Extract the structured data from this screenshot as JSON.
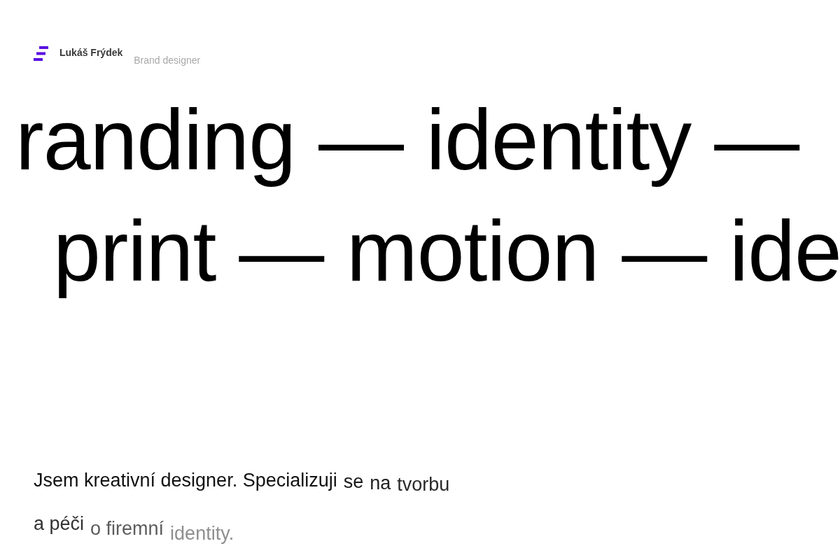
{
  "header": {
    "name": "Lukáš Frýdek",
    "role": "Brand designer"
  },
  "marquee": [
    "randing — identity —",
    "print — motion — ide"
  ],
  "intro": [
    [
      {
        "text": "Jsem kreativní designer. Specializuji",
        "color": "#111111"
      },
      {
        "text": "se",
        "color": "#1a1a1a"
      },
      {
        "text": "na",
        "color": "#222222"
      },
      {
        "text": "tvorbu",
        "color": "#2a2a2a"
      }
    ],
    [
      {
        "text": "a péči",
        "color": "#333333"
      },
      {
        "text": "o firemní",
        "color": "#5c5c5c"
      },
      {
        "text": "identity.",
        "color": "#8f8f8f"
      }
    ]
  ]
}
